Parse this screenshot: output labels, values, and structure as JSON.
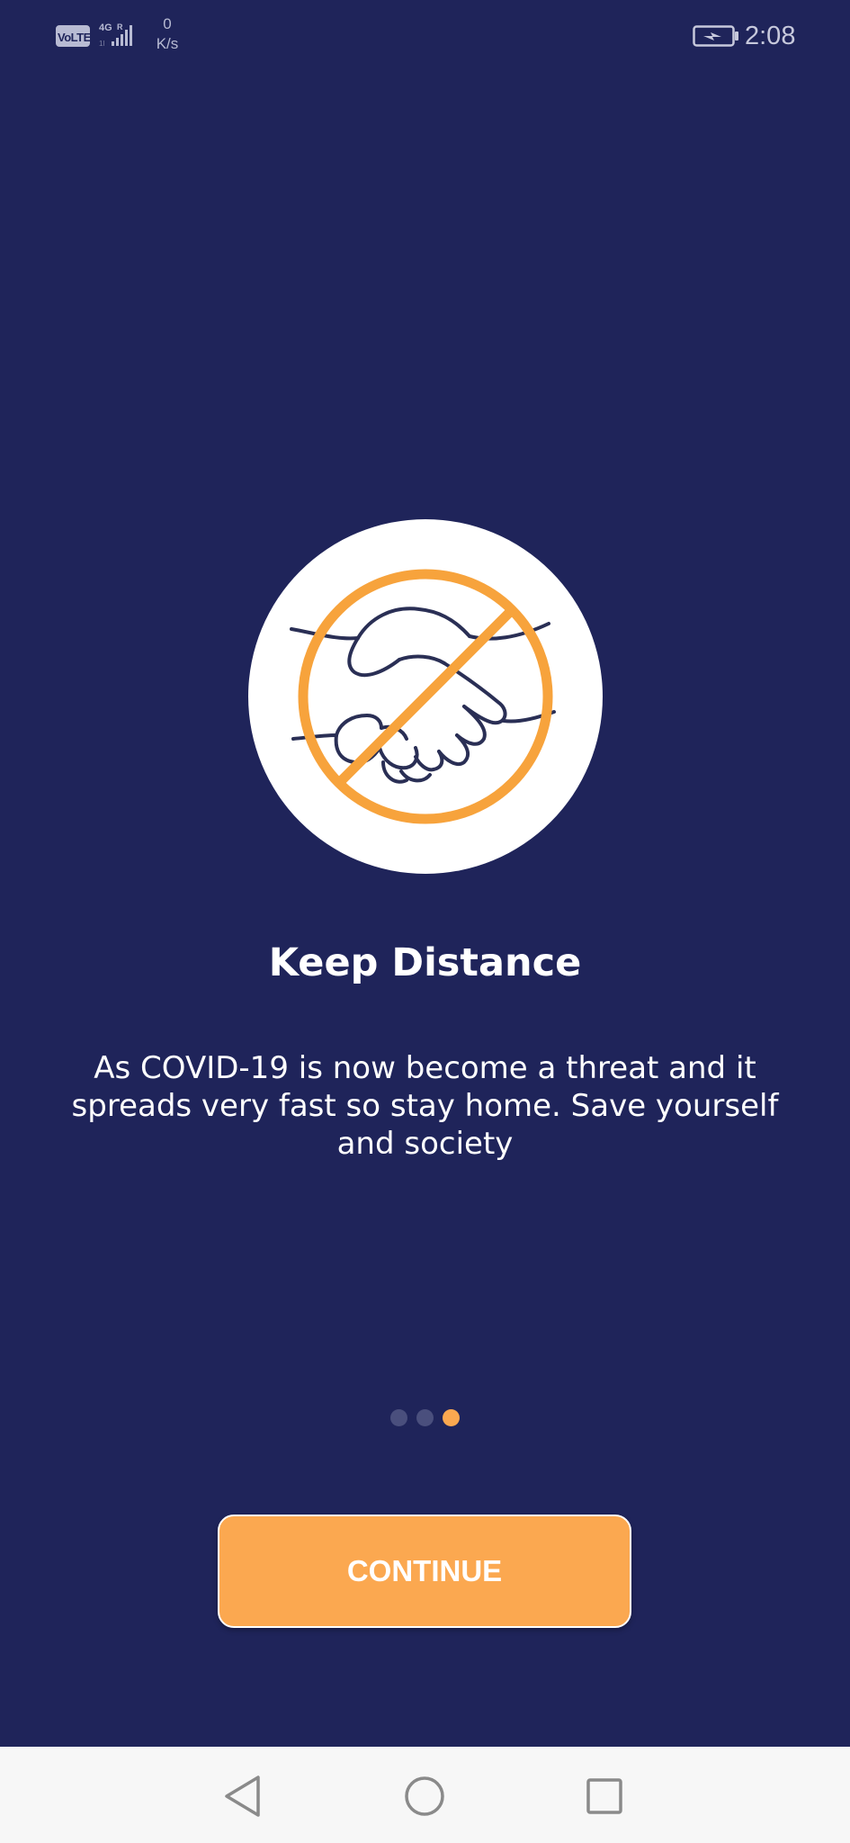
{
  "status_bar": {
    "volte_label": "VoLTE",
    "network_label": "4G R",
    "speed_value": "0",
    "speed_unit": "K/s",
    "time": "2:08",
    "icons": [
      "volte-icon",
      "signal-icon",
      "battery-charging-icon"
    ]
  },
  "illustration": {
    "icon": "no-handshake-icon",
    "colors": {
      "circle": "#ffffff",
      "prohibit": "#f7a33c",
      "line_art": "#2a2f55"
    }
  },
  "content": {
    "title": "Keep Distance",
    "description": "As COVID-19 is now become a threat and it spreads very fast so stay home. Save yourself and society"
  },
  "pager": {
    "total": 3,
    "active_index": 2,
    "colors": {
      "inactive": "#4a4f7d",
      "active": "#fba850"
    }
  },
  "continue_button": {
    "label": "CONTINUE",
    "color": "#fba850"
  },
  "nav_bar": {
    "icons": [
      "back-triangle-icon",
      "home-circle-icon",
      "recents-square-icon"
    ]
  },
  "theme": {
    "background": "#1f245a",
    "accent": "#fba850"
  }
}
